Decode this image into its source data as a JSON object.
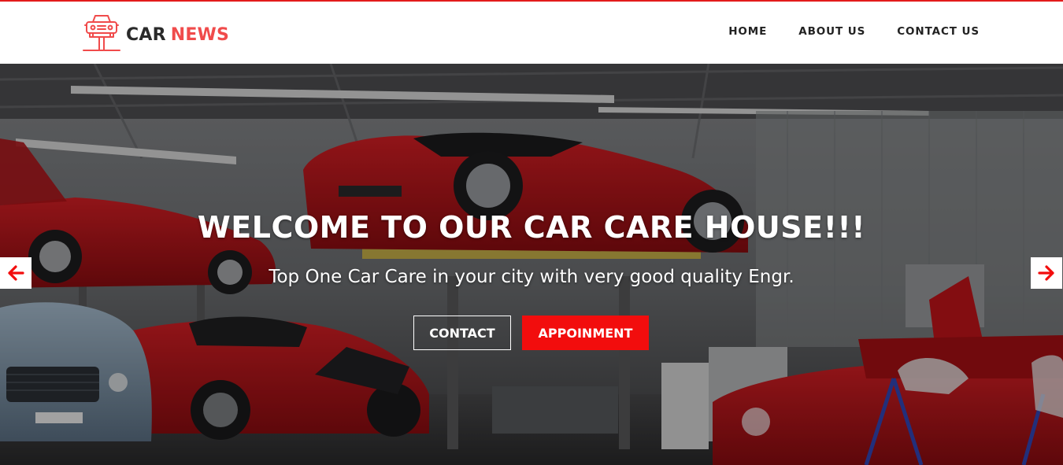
{
  "brand": {
    "name_part1": "CAR",
    "name_part2": "NEWS",
    "icon": "car-lift-icon",
    "colors": {
      "primary": "#f04b4b",
      "dark": "#2a2a2a"
    }
  },
  "nav": {
    "items": [
      {
        "label": "HOME"
      },
      {
        "label": "ABOUT US"
      },
      {
        "label": "CONTACT US"
      }
    ]
  },
  "hero": {
    "title": "WELCOME TO OUR CAR CARE HOUSE!!!",
    "subtitle": "Top One Car Care in your city with very good quality Engr.",
    "buttons": {
      "contact_label": "CONTACT",
      "appointment_label": "APPOINMENT"
    },
    "accent_color": "#f20d0d",
    "prev_icon": "arrow-left-icon",
    "next_icon": "arrow-right-icon",
    "background": "car-garage-photo"
  }
}
